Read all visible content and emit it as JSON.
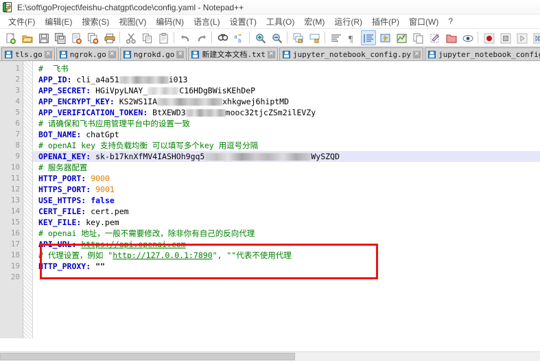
{
  "window": {
    "title": "E:\\soft\\goProject\\feishu-chatgpt\\code\\config.yaml - Notepad++",
    "icon": "notepadpp-icon"
  },
  "menu": {
    "items": [
      {
        "label": "文件(F)"
      },
      {
        "label": "编辑(E)"
      },
      {
        "label": "搜索(S)"
      },
      {
        "label": "视图(V)"
      },
      {
        "label": "编码(N)"
      },
      {
        "label": "语言(L)"
      },
      {
        "label": "设置(T)"
      },
      {
        "label": "工具(O)"
      },
      {
        "label": "宏(M)"
      },
      {
        "label": "运行(R)"
      },
      {
        "label": "插件(P)"
      },
      {
        "label": "窗口(W)"
      },
      {
        "label": "?"
      }
    ]
  },
  "toolbar": {
    "buttons": [
      {
        "name": "new-file-icon"
      },
      {
        "name": "open-file-icon"
      },
      {
        "name": "save-icon"
      },
      {
        "name": "save-all-icon"
      },
      {
        "name": "close-file-icon"
      },
      {
        "name": "close-all-icon"
      },
      {
        "name": "print-icon"
      },
      {
        "name": "cut-icon"
      },
      {
        "name": "copy-icon"
      },
      {
        "name": "paste-icon"
      },
      {
        "name": "undo-icon"
      },
      {
        "name": "redo-icon"
      },
      {
        "name": "find-icon"
      },
      {
        "name": "replace-icon"
      },
      {
        "name": "zoom-in-icon"
      },
      {
        "name": "zoom-out-icon"
      },
      {
        "name": "sync-vertical-scroll-icon"
      },
      {
        "name": "sync-horizontal-scroll-icon"
      },
      {
        "name": "word-wrap-icon"
      },
      {
        "name": "show-all-chars-icon"
      },
      {
        "name": "indent-guide-icon"
      },
      {
        "name": "user-defined-dialog-icon"
      },
      {
        "name": "document-map-icon"
      },
      {
        "name": "function-list-icon"
      },
      {
        "name": "document-switcher-icon"
      },
      {
        "name": "folder-as-workspace-icon"
      },
      {
        "name": "monitoring-icon"
      },
      {
        "name": "macro-record-icon"
      },
      {
        "name": "macro-stop-icon"
      },
      {
        "name": "macro-play-icon"
      },
      {
        "name": "macro-playback-multiple-icon"
      },
      {
        "name": "macro-save-icon"
      }
    ]
  },
  "tabs": [
    {
      "label": "tls.go",
      "active": false
    },
    {
      "label": "ngrok.go",
      "active": false
    },
    {
      "label": "ngrokd.go",
      "active": false
    },
    {
      "label": "新建文本文档.txt",
      "active": false
    },
    {
      "label": "jupyter_notebook_config.py",
      "active": false
    },
    {
      "label": "jupyter_notebook_config.json",
      "active": false
    }
  ],
  "editor": {
    "line_numbers": [
      1,
      2,
      3,
      4,
      5,
      6,
      7,
      8,
      9,
      10,
      11,
      12,
      13,
      14,
      15,
      16,
      17,
      18,
      19,
      20
    ],
    "current_line": 10,
    "lines": [
      {
        "n": 1,
        "text": "#  飞书"
      },
      {
        "n": 2,
        "text": "APP_ID: cli_a4a51         i013"
      },
      {
        "n": 3,
        "text": "APP_SECRET: HGiVpyLNAY_     C16HDgBWisKEhDeP"
      },
      {
        "n": 4,
        "text": "APP_ENCRYPT_KEY: KS2WS1IA          xhkgwej6hiptMD"
      },
      {
        "n": 5,
        "text": "APP_VERIFICATION_TOKEN: BtXEWD3       mooc32tjcZSm2ilEVZy"
      },
      {
        "n": 6,
        "text": "# 请确保和飞书应用管理平台中的设置一致"
      },
      {
        "n": 7,
        "text": "BOT_NAME: chatGpt"
      },
      {
        "n": 8,
        "text": "# openAI key 支持负载均衡 可以填写多个key 用逗号分隔"
      },
      {
        "n": 9,
        "text": "OPENAI_KEY: sk-b17knXfMV4IASHOh9gq5           WySZQD"
      },
      {
        "n": 10,
        "text": "# 服务器配置"
      },
      {
        "n": 11,
        "text": "HTTP_PORT: 9000"
      },
      {
        "n": 12,
        "text": "HTTPS_PORT: 9001"
      },
      {
        "n": 13,
        "text": "USE_HTTPS: false"
      },
      {
        "n": 14,
        "text": "CERT_FILE: cert.pem"
      },
      {
        "n": 15,
        "text": "KEY_FILE: key.pem"
      },
      {
        "n": 16,
        "text": "# openai 地址，一般不需要修改，除非你有自己的反向代理"
      },
      {
        "n": 17,
        "text": "API_URL: https://api.openai.com"
      },
      {
        "n": 18,
        "text": "# 代理设置，例如 \"http://127.0.0.1:7890\", \"\"代表不使用代理"
      },
      {
        "n": 19,
        "text": "HTTP_PROXY: \"\""
      }
    ],
    "tokens": {
      "comment_feishu": "#  飞书",
      "key_app_id": "APP_ID:",
      "val_app_id_pre": " cli_a4a51",
      "val_app_id_post": "i013",
      "key_app_secret": "APP_SECRET:",
      "val_app_secret_pre": " HGiVpyLNAY_",
      "val_app_secret_post": "C16HDgBWisKEhDeP",
      "key_app_encrypt": "APP_ENCRYPT_KEY:",
      "val_app_encrypt_pre": " KS2WS1IA",
      "val_app_encrypt_post": "xhkgwej6hiptMD",
      "key_app_verification": "APP_VERIFICATION_TOKEN:",
      "val_app_verification_pre": " BtXEWD3",
      "val_app_verification_post": "mooc32tjcZSm2ilEVZy",
      "comment_feishu_platform": "# 请确保和飞书应用管理平台中的设置一致",
      "key_bot_name": "BOT_NAME:",
      "val_bot_name": " chatGpt",
      "comment_openai_key": "# openAI key 支持负载均衡 可以填写多个key 用逗号分隔",
      "key_openai_key": "OPENAI_KEY:",
      "val_openai_key_pre": " sk-b17knXfMV4IASHOh9gq5",
      "val_openai_key_post": "WySZQD",
      "comment_server": "# 服务器配置",
      "key_http_port": "HTTP_PORT:",
      "val_http_port": "9000",
      "key_https_port": "HTTPS_PORT:",
      "val_https_port": "9001",
      "key_use_https": "USE_HTTPS:",
      "val_use_https": "false",
      "key_cert_file": "CERT_FILE:",
      "val_cert_file": " cert.pem",
      "key_key_file": "KEY_FILE:",
      "val_key_file": " key.pem",
      "comment_openai_url": "# openai 地址，一般不需要修改，除非你有自己的反向代理",
      "key_api_url": "API_URL:",
      "val_api_url": "https://api.openai.com",
      "comment_proxy_a": "# 代理设置，例如 ",
      "comment_proxy_url": "http://127.0.0.1:7890",
      "comment_proxy_b": "\", \"\"代表不使用代理",
      "comment_proxy_quote": "\"",
      "key_http_proxy": "HTTP_PROXY:",
      "val_http_proxy": " \"\""
    }
  },
  "annotation": {
    "name": "red-highlight-box",
    "color": "#ee1111"
  },
  "colors": {
    "key": "#0000c0",
    "comment": "#008000",
    "number": "#e07b00",
    "keyword": "#0000ff",
    "current_line_bg": "#e6e6fa",
    "gutter_bg": "#e4e4e4",
    "tab_bg": "#d4d4d4",
    "annotation_red": "#ee1111"
  }
}
